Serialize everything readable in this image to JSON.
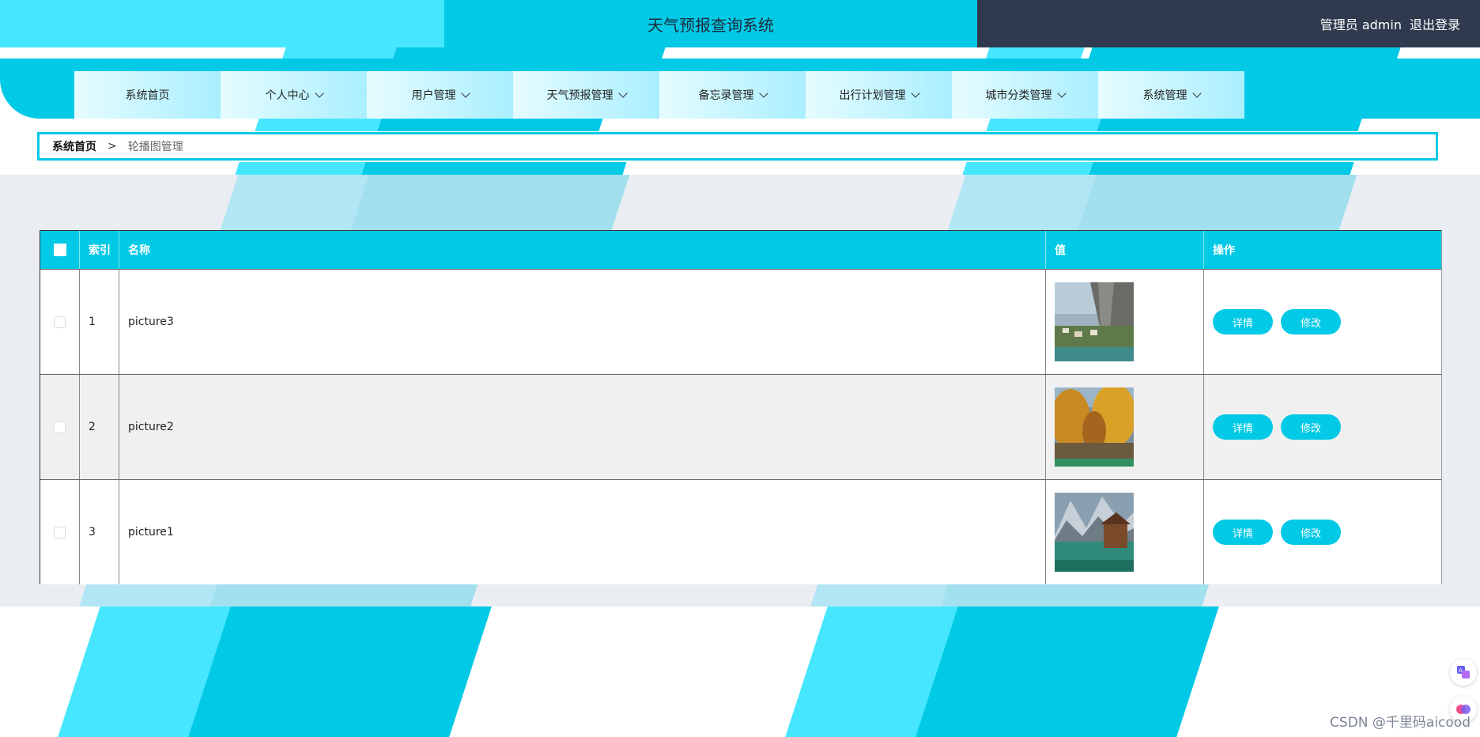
{
  "header": {
    "title": "天气预报查询系统",
    "user_label": "管理员 admin",
    "logout": "退出登录"
  },
  "nav": {
    "items": [
      {
        "label": "系统首页",
        "dropdown": false
      },
      {
        "label": "个人中心",
        "dropdown": true
      },
      {
        "label": "用户管理",
        "dropdown": true
      },
      {
        "label": "天气预报管理",
        "dropdown": true
      },
      {
        "label": "备忘录管理",
        "dropdown": true
      },
      {
        "label": "出行计划管理",
        "dropdown": true
      },
      {
        "label": "城市分类管理",
        "dropdown": true
      },
      {
        "label": "系统管理",
        "dropdown": true
      }
    ]
  },
  "breadcrumb": {
    "home": "系统首页",
    "separator": ">",
    "current": "轮播图管理"
  },
  "table": {
    "headers": [
      "索引",
      "名称",
      "值",
      "操作"
    ],
    "rows": [
      {
        "index": "1",
        "name": "picture3",
        "image": "cliff-town-landscape"
      },
      {
        "index": "2",
        "name": "picture2",
        "image": "autumn-trees-landscape"
      },
      {
        "index": "3",
        "name": "picture1",
        "image": "lake-mountain-landscape"
      }
    ],
    "actions": {
      "detail": "详情",
      "edit": "修改"
    }
  },
  "watermark": "CSDN @千里码aicood",
  "colors": {
    "primary": "#02c9e6",
    "light": "#46e6ff",
    "dark": "#2f3a4e",
    "content_bg": "#eaedf2"
  }
}
